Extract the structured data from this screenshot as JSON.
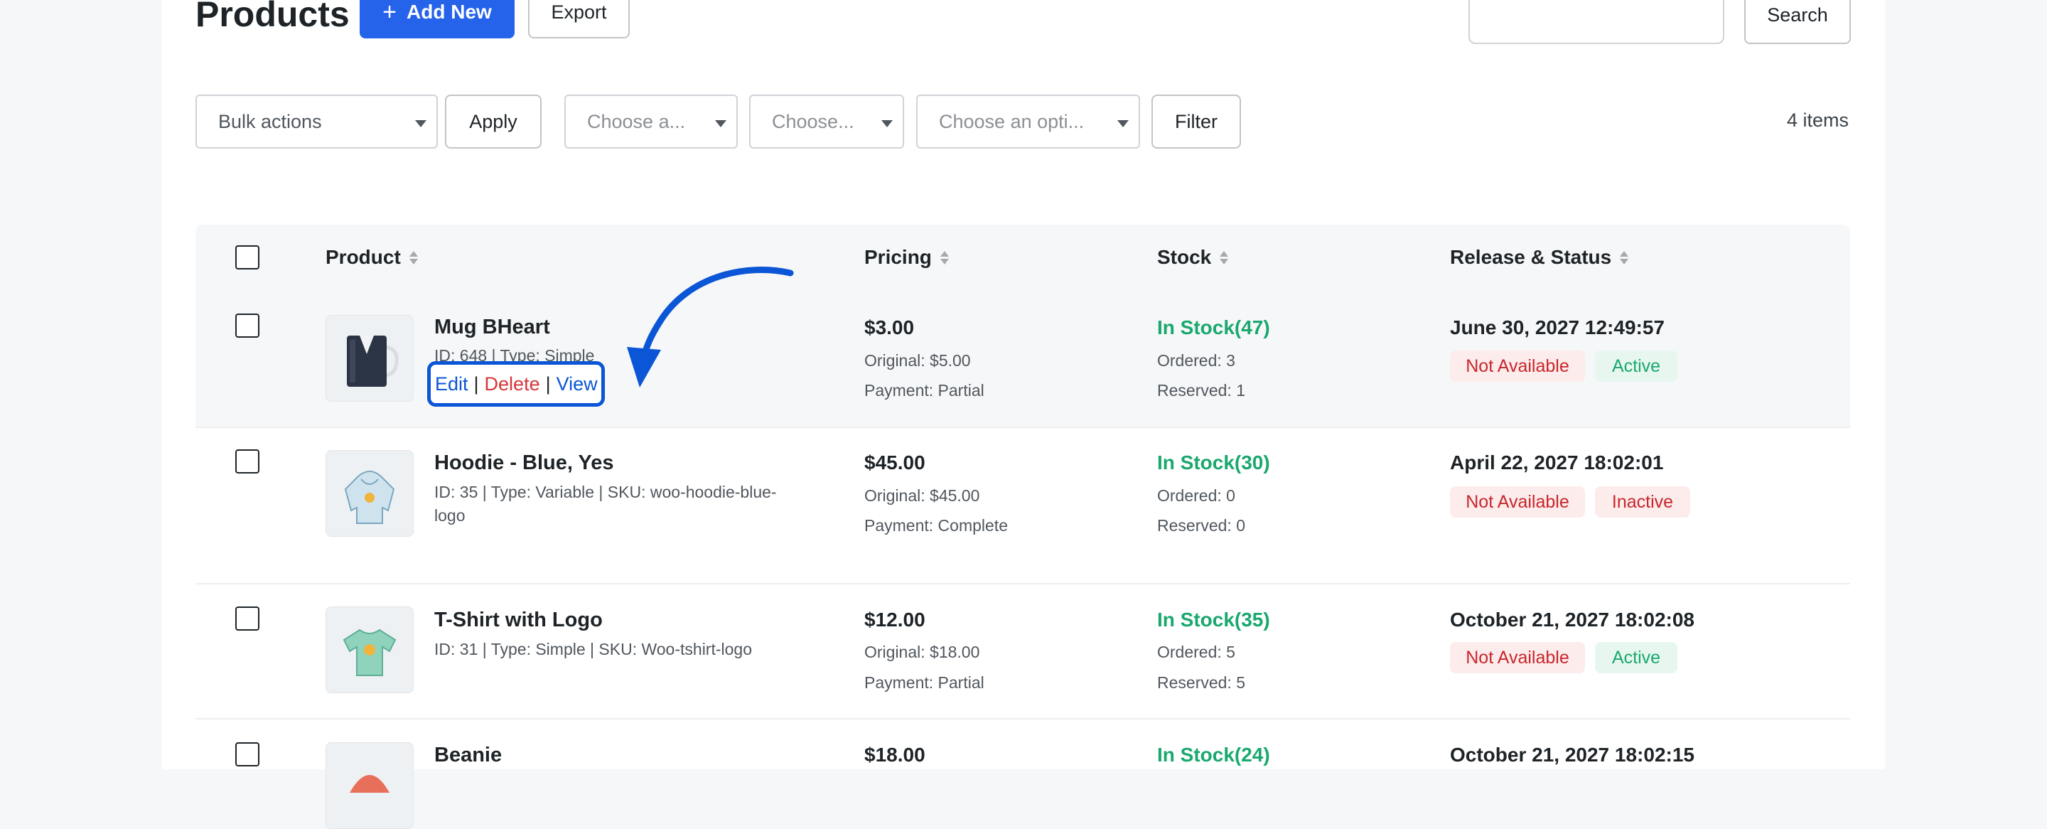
{
  "header": {
    "title": "Products",
    "add_new_label": "Add New",
    "export_label": "Export",
    "search_value": "",
    "search_button_label": "Search"
  },
  "toolbar": {
    "bulk_actions": "Bulk actions",
    "apply_label": "Apply",
    "filter1": "Choose a...",
    "filter2": "Choose...",
    "filter3": "Choose an opti...",
    "filter_label": "Filter",
    "items_count": "4 items"
  },
  "table": {
    "columns": [
      "Product",
      "Pricing",
      "Stock",
      "Release & Status"
    ],
    "rows": [
      {
        "name": "Mug BHeart",
        "meta": "ID: 648 | Type: Simple",
        "price": "$3.00",
        "original": "Original: $5.00",
        "payment": "Payment: Partial",
        "stock": "In Stock(47)",
        "ordered": "Ordered: 3",
        "reserved": "Reserved: 1",
        "date": "June 30, 2027 12:49:57",
        "availability": "Not Available",
        "status": "Active"
      },
      {
        "name": "Hoodie - Blue, Yes",
        "meta": "ID: 35 | Type: Variable | SKU: woo-hoodie-blue-logo",
        "price": "$45.00",
        "original": "Original: $45.00",
        "payment": "Payment: Complete",
        "stock": "In Stock(30)",
        "ordered": "Ordered: 0",
        "reserved": "Reserved: 0",
        "date": "April 22, 2027 18:02:01",
        "availability": "Not Available",
        "status": "Inactive"
      },
      {
        "name": "T-Shirt with Logo",
        "meta": "ID: 31 | Type: Simple | SKU: Woo-tshirt-logo",
        "price": "$12.00",
        "original": "Original: $18.00",
        "payment": "Payment: Partial",
        "stock": "In Stock(35)",
        "ordered": "Ordered: 5",
        "reserved": "Reserved: 5",
        "date": "October 21, 2027 18:02:08",
        "availability": "Not Available",
        "status": "Active"
      },
      {
        "name": "Beanie",
        "price": "$18.00",
        "stock": "In Stock(24)",
        "date": "October 21, 2027 18:02:15"
      }
    ]
  },
  "row_actions": {
    "edit": "Edit",
    "delete": "Delete",
    "view": "View",
    "separator": "|"
  },
  "colors": {
    "primary": "#2563eb",
    "annotation": "#0a56d6",
    "in_stock": "#1aa86e",
    "danger": "#c8262b"
  }
}
